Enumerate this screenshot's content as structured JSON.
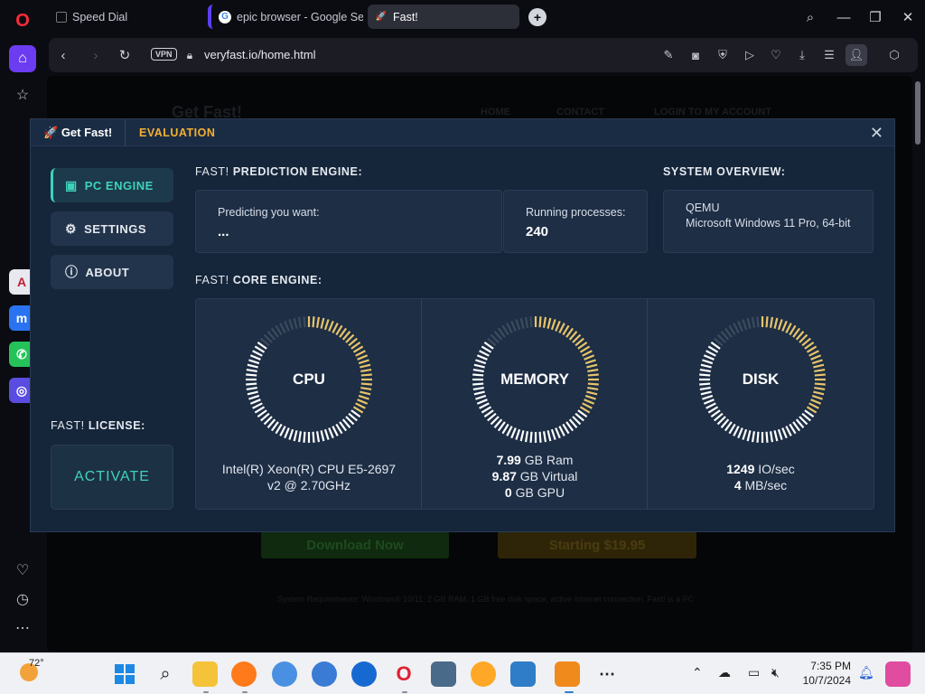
{
  "browser": {
    "tabs": [
      {
        "title": "Speed Dial"
      },
      {
        "title": "epic browser - Google Se"
      },
      {
        "title": "Fast!"
      }
    ],
    "vpn_badge": "VPN",
    "url": "veryfast.io/home.html"
  },
  "webpage_behind": {
    "logo_text": "Get Fast!",
    "nav": [
      "HOME",
      "CONTACT",
      "LOGIN TO MY ACCOUNT"
    ],
    "download_button": "Download Now",
    "pricing_button": "Starting $19.95",
    "footer_text": "System Requirements: Windows® 10/11, 2 GB RAM, 1 GB free disk space, active internet connection. Fast! is a PC optimization tool."
  },
  "modal": {
    "brand": "Get Fast!",
    "mode": "EVALUATION",
    "nav": [
      {
        "label": "PC ENGINE",
        "icon": "chip-icon",
        "active": true
      },
      {
        "label": "SETTINGS",
        "icon": "gear-icon",
        "active": false
      },
      {
        "label": "ABOUT",
        "icon": "info-icon",
        "active": false
      }
    ],
    "license": {
      "title_prefix": "FAST!",
      "title_suffix": "LICENSE:",
      "button": "ACTIVATE"
    },
    "prediction": {
      "title_prefix": "FAST!",
      "title_suffix": "PREDICTION ENGINE:",
      "predicting_label": "Predicting you want:",
      "predicting_value": "...",
      "processes_label": "Running processes:",
      "processes_value": "240"
    },
    "system": {
      "title": "SYSTEM OVERVIEW:",
      "line1": "QEMU",
      "line2": "Microsoft Windows 11 Pro, 64-bit"
    },
    "core": {
      "title_prefix": "FAST!",
      "title_suffix": "CORE ENGINE:",
      "cpu": {
        "label": "CPU",
        "level": 0.35,
        "info": "Intel(R) Xeon(R) CPU E5-2697 v2 @ 2.70GHz"
      },
      "memory": {
        "label": "MEMORY",
        "level": 0.35,
        "ram_value": "7.99",
        "ram_unit": "GB Ram",
        "virtual_value": "9.87",
        "virtual_unit": "GB Virtual",
        "gpu_value": "0",
        "gpu_unit": "GB GPU"
      },
      "disk": {
        "label": "DISK",
        "level": 0.35,
        "io_value": "1249",
        "io_unit": "IO/sec",
        "mb_value": "4",
        "mb_unit": "MB/sec"
      }
    }
  },
  "taskbar": {
    "weather_temp": "72°",
    "time": "7:35 PM",
    "date": "10/7/2024"
  },
  "colors": {
    "accent_teal": "#3ed2b8",
    "accent_gold": "#f4b030",
    "gauge_active": "#e8c46a",
    "gauge_idle": "#ffffff"
  }
}
